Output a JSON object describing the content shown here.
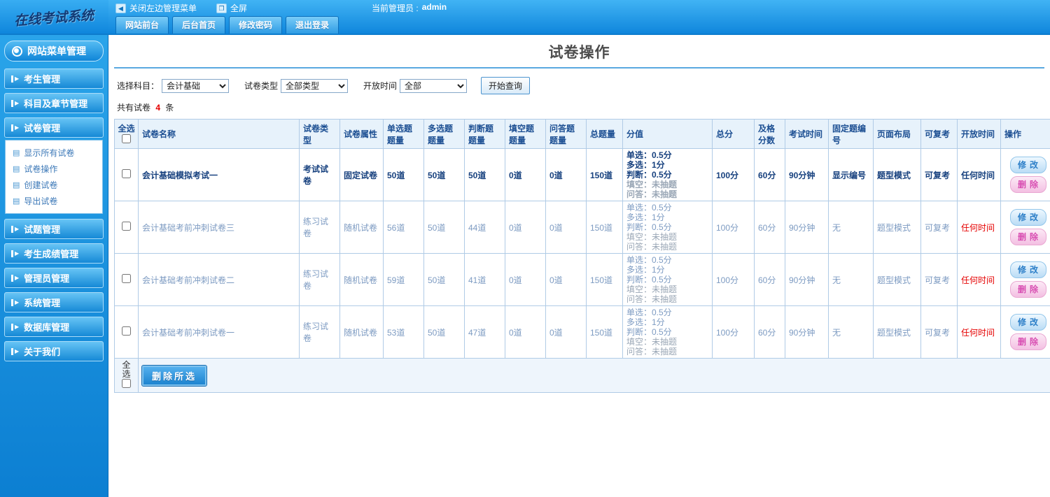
{
  "topbar": {
    "logo": "在线考试系统",
    "close_menu": "关闭左边管理菜单",
    "fullscreen": "全屏",
    "admin_label": "当前管理员 :",
    "admin_name": "admin",
    "tabs": [
      "网站前台",
      "后台首页",
      "修改密码",
      "退出登录"
    ]
  },
  "sidebar": {
    "header": "网站菜单管理",
    "items": [
      {
        "label": "考生管理"
      },
      {
        "label": "科目及章节管理"
      },
      {
        "label": "试卷管理"
      },
      {
        "label": "试题管理"
      },
      {
        "label": "考生成绩管理"
      },
      {
        "label": "管理员管理"
      },
      {
        "label": "系统管理"
      },
      {
        "label": "数据库管理"
      },
      {
        "label": "关于我们"
      }
    ],
    "submenu": [
      "显示所有试卷",
      "试卷操作",
      "创建试卷",
      "导出试卷"
    ]
  },
  "main": {
    "title": "试卷操作",
    "filters": {
      "subject_label": "选择科目：",
      "subject_value": "会计基础",
      "type_label": "试卷类型",
      "type_value": "全部类型",
      "time_label": "开放时间",
      "time_value": "全部",
      "query_button": "开始查询"
    },
    "summary": {
      "prefix": "共有试卷",
      "count": "4",
      "suffix": "条"
    },
    "table": {
      "headers": [
        "全选",
        "试卷名称",
        "试卷类型",
        "试卷属性",
        "单选题题量",
        "多选题题量",
        "判断题题量",
        "填空题题量",
        "问答题题量",
        "总题量",
        "分值",
        "总分",
        "及格分数",
        "考试时间",
        "固定题编号",
        "页面布局",
        "可复考",
        "开放时间",
        "操作"
      ],
      "actions": {
        "edit": "修改",
        "delete": "删除"
      },
      "rows": [
        {
          "bold": true,
          "name": "会计基础模拟考试一",
          "type": "考试试卷",
          "attr": "固定试卷",
          "single": "50道",
          "multi": "50道",
          "judge": "50道",
          "blank": "0道",
          "qa": "0道",
          "total_q": "150道",
          "score_lines": [
            "单选：0.5分",
            "多选：1分",
            "判断：0.5分",
            "填空：未抽题",
            "问答：未抽题"
          ],
          "total_score": "100分",
          "pass_score": "60分",
          "exam_time": "90分钟",
          "fixed_no": "显示编号",
          "layout": "题型模式",
          "retake": "可复考",
          "open_time": "任何时间"
        },
        {
          "bold": false,
          "name": "会计基础考前冲刺试卷三",
          "type": "练习试卷",
          "attr": "随机试卷",
          "single": "56道",
          "multi": "50道",
          "judge": "44道",
          "blank": "0道",
          "qa": "0道",
          "total_q": "150道",
          "score_lines": [
            "单选：0.5分",
            "多选：1分",
            "判断：0.5分",
            "填空：未抽题",
            "问答：未抽题"
          ],
          "total_score": "100分",
          "pass_score": "60分",
          "exam_time": "90分钟",
          "fixed_no": "无",
          "layout": "题型模式",
          "retake": "可复考",
          "open_time": "任何时间"
        },
        {
          "bold": false,
          "name": "会计基础考前冲刺试卷二",
          "type": "练习试卷",
          "attr": "随机试卷",
          "single": "59道",
          "multi": "50道",
          "judge": "41道",
          "blank": "0道",
          "qa": "0道",
          "total_q": "150道",
          "score_lines": [
            "单选：0.5分",
            "多选：1分",
            "判断：0.5分",
            "填空：未抽题",
            "问答：未抽题"
          ],
          "total_score": "100分",
          "pass_score": "60分",
          "exam_time": "90分钟",
          "fixed_no": "无",
          "layout": "题型模式",
          "retake": "可复考",
          "open_time": "任何时间"
        },
        {
          "bold": false,
          "name": "会计基础考前冲刺试卷一",
          "type": "练习试卷",
          "attr": "随机试卷",
          "single": "53道",
          "multi": "50道",
          "judge": "47道",
          "blank": "0道",
          "qa": "0道",
          "total_q": "150道",
          "score_lines": [
            "单选：0.5分",
            "多选：1分",
            "判断：0.5分",
            "填空：未抽题",
            "问答：未抽题"
          ],
          "total_score": "100分",
          "pass_score": "60分",
          "exam_time": "90分钟",
          "fixed_no": "无",
          "layout": "题型模式",
          "retake": "可复考",
          "open_time": "任何时间"
        }
      ],
      "footer": {
        "select_all": "全选",
        "delete_selected": "删除所选"
      }
    }
  }
}
